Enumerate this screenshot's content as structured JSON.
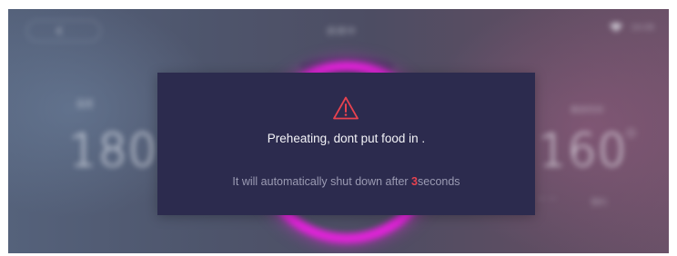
{
  "background": {
    "title": "烘烤中",
    "time": "16:08",
    "left_label": "温度",
    "left_temp": "180",
    "right_label": "剩余时间",
    "right_temp": "160",
    "sub_left": "— —",
    "sub_right": "预约"
  },
  "dialog": {
    "icon": "warning-triangle-icon",
    "title": "Preheating, dont put food in .",
    "sub_prefix": "It will automatically shut down after ",
    "countdown": "3",
    "sub_suffix": "seconds"
  },
  "colors": {
    "dialog_bg": "#2c2b4e",
    "warning": "#e8424f",
    "dial_ring": "#e023d8"
  }
}
